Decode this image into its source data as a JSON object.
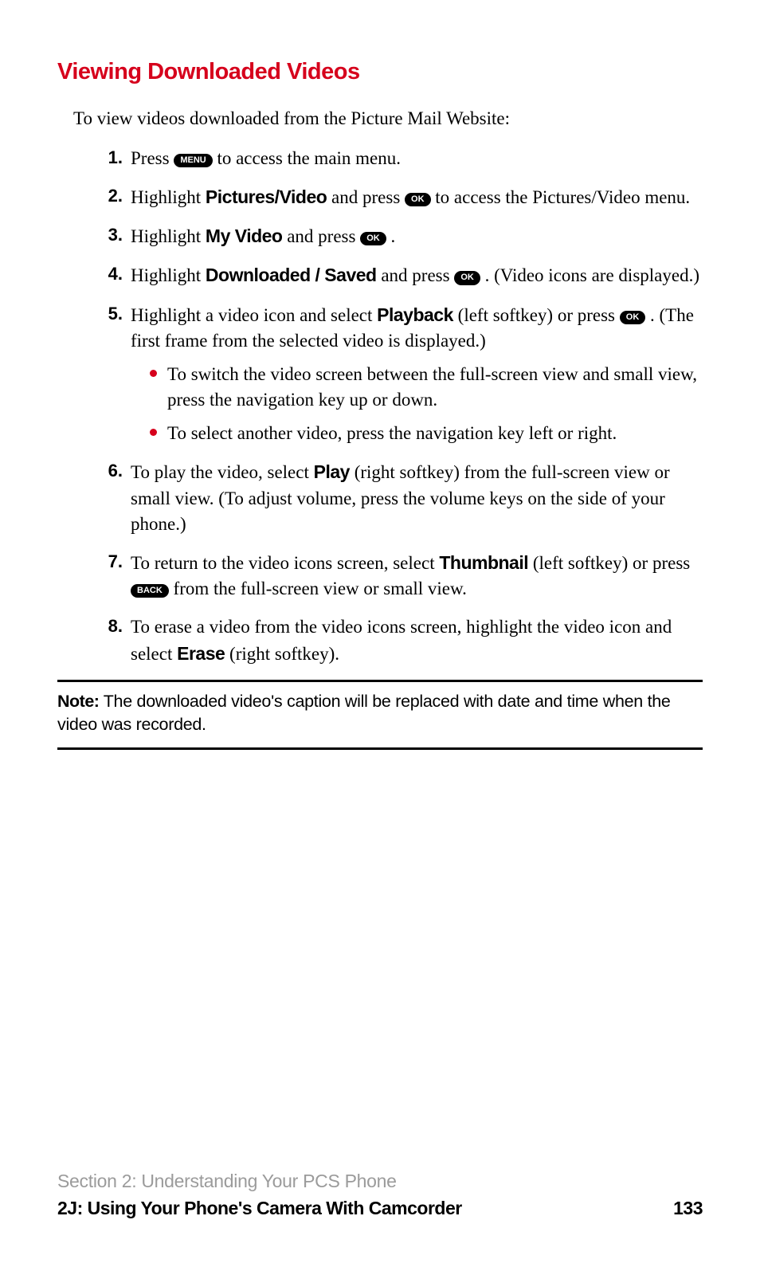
{
  "heading": "Viewing Downloaded Videos",
  "intro": "To view videos downloaded from the Picture Mail Website:",
  "keys": {
    "menu": "MENU",
    "ok": "OK",
    "back": "BACK"
  },
  "steps": {
    "s1": {
      "num": "1.",
      "a": "Press ",
      "b": " to access the main menu."
    },
    "s2": {
      "num": "2.",
      "a": "Highlight ",
      "bold": "Pictures/Video",
      "b": " and press ",
      "c": " to access the Pictures/Video menu."
    },
    "s3": {
      "num": "3.",
      "a": "Highlight ",
      "bold": "My Video",
      "b": " and press ",
      "c": " ."
    },
    "s4": {
      "num": "4.",
      "a": "Highlight ",
      "bold": "Downloaded / Saved",
      "b": " and press ",
      "c": " . (Video icons are displayed.)"
    },
    "s5": {
      "num": "5.",
      "a": "Highlight a video icon and select ",
      "bold": "Playback",
      "b": " (left softkey) or press ",
      "c": " . (The first frame from the selected video is displayed.)",
      "sub1": "To switch the video screen between the full-screen view and small view, press the navigation key up or down.",
      "sub2": "To select another video, press the navigation key left or right."
    },
    "s6": {
      "num": "6.",
      "a": "To play the video, select ",
      "bold": "Play",
      "b": " (right softkey) from the full-screen view or small view. (To adjust volume, press the volume keys on the side of your phone.)"
    },
    "s7": {
      "num": "7.",
      "a": "To return to the video icons screen, select ",
      "bold": "Thumbnail",
      "b": " (left softkey) or press ",
      "c": " from the full-screen view or small view."
    },
    "s8": {
      "num": "8.",
      "a": "To erase a video from the video icons screen, highlight the video icon and select ",
      "bold": "Erase",
      "b": " (right softkey)."
    }
  },
  "note": {
    "label": "Note:",
    "text": " The downloaded video's caption will be replaced with date and time when the video was recorded."
  },
  "footer": {
    "line1": "Section 2: Understanding Your PCS Phone",
    "line2": "2J: Using Your Phone's Camera With Camcorder",
    "page": "133"
  }
}
